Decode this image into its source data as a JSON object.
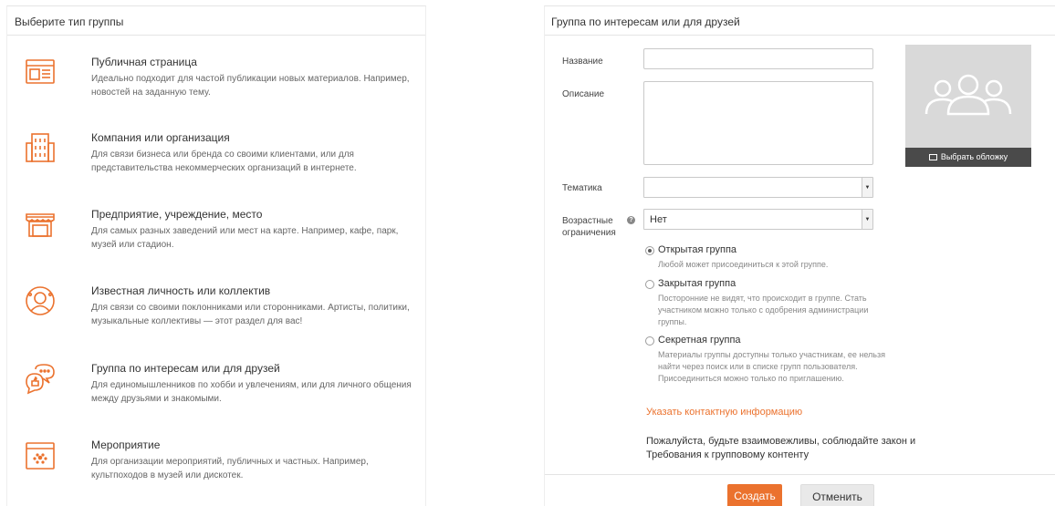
{
  "left": {
    "title": "Выберите тип группы",
    "items": [
      {
        "icon": "public-page-icon",
        "title": "Публичная страница",
        "desc": "Идеально подходит для частой публикации новых материалов. Например, новостей на заданную тему."
      },
      {
        "icon": "company-building-icon",
        "title": "Компания или организация",
        "desc": "Для связи бизнеса или бренда со своими клиентами, или для представительства некоммерческих организаций в интернете."
      },
      {
        "icon": "storefront-icon",
        "title": "Предприятие, учреждение, место",
        "desc": "Для самых разных заведений или мест на карте. Например, кафе, парк, музей или стадион."
      },
      {
        "icon": "celebrity-icon",
        "title": "Известная личность или коллектив",
        "desc": "Для связи со своими поклонниками или сторонниками. Артисты, политики, музыкальные коллективы — этот раздел для вас!"
      },
      {
        "icon": "chat-bubbles-icon",
        "title": "Группа по интересам или для друзей",
        "desc": "Для единомышленников по хобби и увлечениям, или для личного общения между друзьями и знакомыми."
      },
      {
        "icon": "calendar-icon",
        "title": "Мероприятие",
        "desc": "Для организации мероприятий, публичных и частных. Например, культпоходов в музей или дискотек."
      }
    ]
  },
  "right": {
    "title": "Группа по интересам или для друзей",
    "name_label": "Название",
    "name_value": "",
    "desc_label": "Описание",
    "desc_value": "",
    "topic_label": "Тематика",
    "topic_value": "",
    "age_label": "Возрастные ограничения",
    "age_value": "Нет",
    "cover_button": "Выбрать обложку",
    "radios": [
      {
        "title": "Открытая группа",
        "desc": "Любой может присоединиться к этой группе.",
        "checked": true
      },
      {
        "title": "Закрытая группа",
        "desc": "Посторонние не видят, что происходит в группе. Стать участником можно только с одобрения администрации группы.",
        "checked": false
      },
      {
        "title": "Секретная группа",
        "desc": "Материалы группы доступны только участникам, ее нельзя найти через поиск или в списке групп пользователя. Присоединиться можно только по приглашению.",
        "checked": false
      }
    ],
    "contact_link": "Указать контактную информацию",
    "polite_text": "Пожалуйста, будьте взаимовежливы, соблюдайте закон и Требования к групповому контенту",
    "create_button": "Создать",
    "cancel_button": "Отменить"
  },
  "colors": {
    "accent": "#eb722e",
    "cover_bg": "#d9d9d9",
    "cover_button_bg": "#4a4a4a"
  }
}
